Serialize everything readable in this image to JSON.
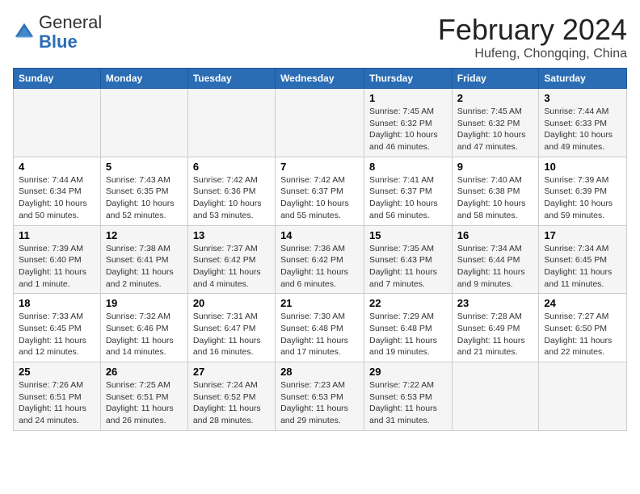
{
  "logo": {
    "general": "General",
    "blue": "Blue"
  },
  "title": "February 2024",
  "subtitle": "Hufeng, Chongqing, China",
  "days_of_week": [
    "Sunday",
    "Monday",
    "Tuesday",
    "Wednesday",
    "Thursday",
    "Friday",
    "Saturday"
  ],
  "weeks": [
    [
      {
        "day": "",
        "info": ""
      },
      {
        "day": "",
        "info": ""
      },
      {
        "day": "",
        "info": ""
      },
      {
        "day": "",
        "info": ""
      },
      {
        "day": "1",
        "info": "Sunrise: 7:45 AM\nSunset: 6:32 PM\nDaylight: 10 hours and 46 minutes."
      },
      {
        "day": "2",
        "info": "Sunrise: 7:45 AM\nSunset: 6:32 PM\nDaylight: 10 hours and 47 minutes."
      },
      {
        "day": "3",
        "info": "Sunrise: 7:44 AM\nSunset: 6:33 PM\nDaylight: 10 hours and 49 minutes."
      }
    ],
    [
      {
        "day": "4",
        "info": "Sunrise: 7:44 AM\nSunset: 6:34 PM\nDaylight: 10 hours and 50 minutes."
      },
      {
        "day": "5",
        "info": "Sunrise: 7:43 AM\nSunset: 6:35 PM\nDaylight: 10 hours and 52 minutes."
      },
      {
        "day": "6",
        "info": "Sunrise: 7:42 AM\nSunset: 6:36 PM\nDaylight: 10 hours and 53 minutes."
      },
      {
        "day": "7",
        "info": "Sunrise: 7:42 AM\nSunset: 6:37 PM\nDaylight: 10 hours and 55 minutes."
      },
      {
        "day": "8",
        "info": "Sunrise: 7:41 AM\nSunset: 6:37 PM\nDaylight: 10 hours and 56 minutes."
      },
      {
        "day": "9",
        "info": "Sunrise: 7:40 AM\nSunset: 6:38 PM\nDaylight: 10 hours and 58 minutes."
      },
      {
        "day": "10",
        "info": "Sunrise: 7:39 AM\nSunset: 6:39 PM\nDaylight: 10 hours and 59 minutes."
      }
    ],
    [
      {
        "day": "11",
        "info": "Sunrise: 7:39 AM\nSunset: 6:40 PM\nDaylight: 11 hours and 1 minute."
      },
      {
        "day": "12",
        "info": "Sunrise: 7:38 AM\nSunset: 6:41 PM\nDaylight: 11 hours and 2 minutes."
      },
      {
        "day": "13",
        "info": "Sunrise: 7:37 AM\nSunset: 6:42 PM\nDaylight: 11 hours and 4 minutes."
      },
      {
        "day": "14",
        "info": "Sunrise: 7:36 AM\nSunset: 6:42 PM\nDaylight: 11 hours and 6 minutes."
      },
      {
        "day": "15",
        "info": "Sunrise: 7:35 AM\nSunset: 6:43 PM\nDaylight: 11 hours and 7 minutes."
      },
      {
        "day": "16",
        "info": "Sunrise: 7:34 AM\nSunset: 6:44 PM\nDaylight: 11 hours and 9 minutes."
      },
      {
        "day": "17",
        "info": "Sunrise: 7:34 AM\nSunset: 6:45 PM\nDaylight: 11 hours and 11 minutes."
      }
    ],
    [
      {
        "day": "18",
        "info": "Sunrise: 7:33 AM\nSunset: 6:45 PM\nDaylight: 11 hours and 12 minutes."
      },
      {
        "day": "19",
        "info": "Sunrise: 7:32 AM\nSunset: 6:46 PM\nDaylight: 11 hours and 14 minutes."
      },
      {
        "day": "20",
        "info": "Sunrise: 7:31 AM\nSunset: 6:47 PM\nDaylight: 11 hours and 16 minutes."
      },
      {
        "day": "21",
        "info": "Sunrise: 7:30 AM\nSunset: 6:48 PM\nDaylight: 11 hours and 17 minutes."
      },
      {
        "day": "22",
        "info": "Sunrise: 7:29 AM\nSunset: 6:48 PM\nDaylight: 11 hours and 19 minutes."
      },
      {
        "day": "23",
        "info": "Sunrise: 7:28 AM\nSunset: 6:49 PM\nDaylight: 11 hours and 21 minutes."
      },
      {
        "day": "24",
        "info": "Sunrise: 7:27 AM\nSunset: 6:50 PM\nDaylight: 11 hours and 22 minutes."
      }
    ],
    [
      {
        "day": "25",
        "info": "Sunrise: 7:26 AM\nSunset: 6:51 PM\nDaylight: 11 hours and 24 minutes."
      },
      {
        "day": "26",
        "info": "Sunrise: 7:25 AM\nSunset: 6:51 PM\nDaylight: 11 hours and 26 minutes."
      },
      {
        "day": "27",
        "info": "Sunrise: 7:24 AM\nSunset: 6:52 PM\nDaylight: 11 hours and 28 minutes."
      },
      {
        "day": "28",
        "info": "Sunrise: 7:23 AM\nSunset: 6:53 PM\nDaylight: 11 hours and 29 minutes."
      },
      {
        "day": "29",
        "info": "Sunrise: 7:22 AM\nSunset: 6:53 PM\nDaylight: 11 hours and 31 minutes."
      },
      {
        "day": "",
        "info": ""
      },
      {
        "day": "",
        "info": ""
      }
    ]
  ]
}
